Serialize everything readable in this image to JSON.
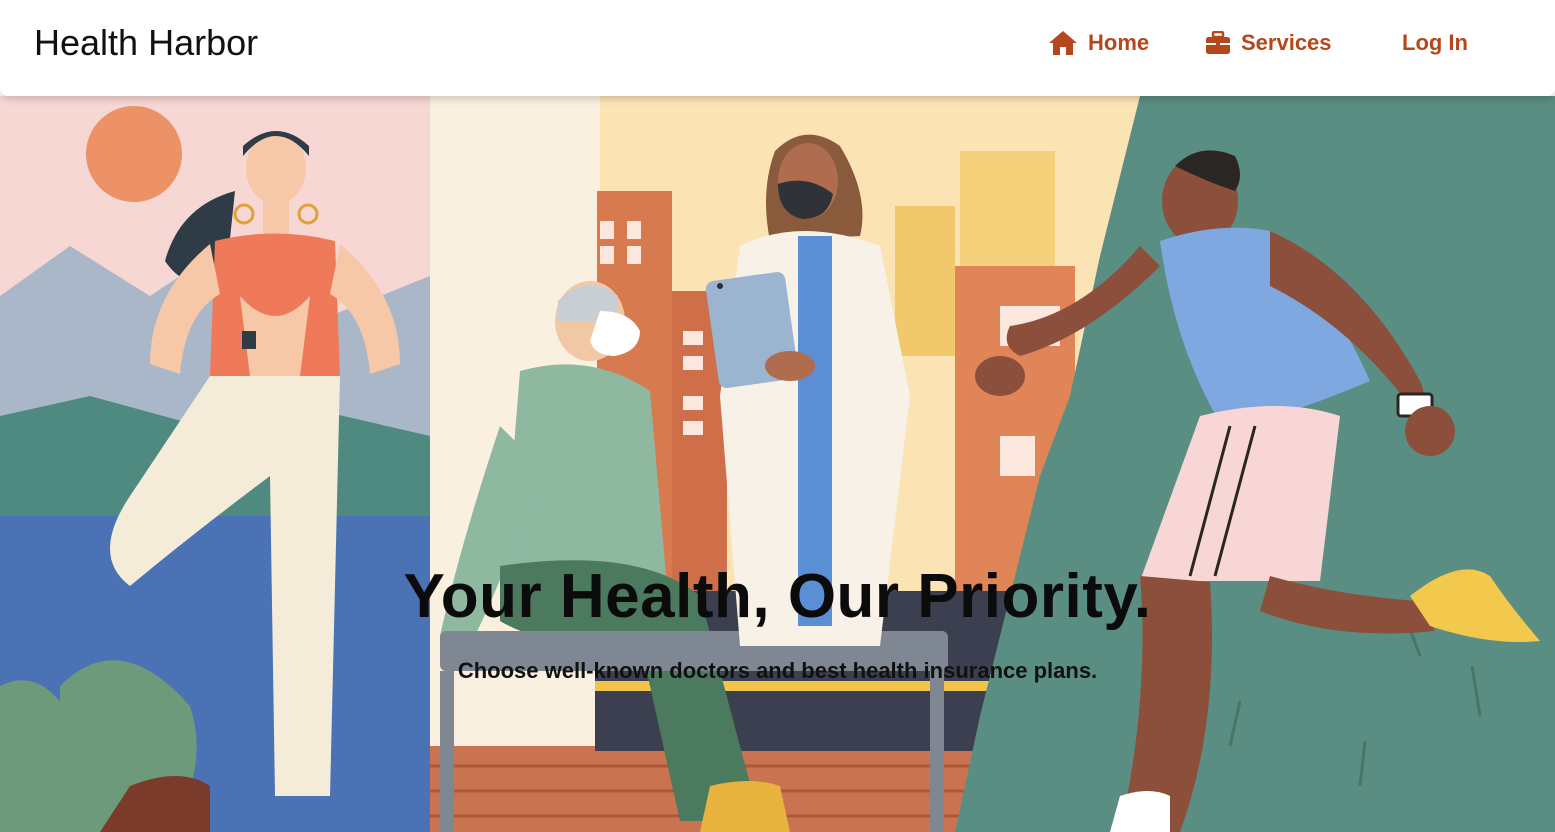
{
  "brand": {
    "name": "Health Harbor"
  },
  "nav": {
    "home": {
      "label": "Home",
      "icon": "home-icon"
    },
    "services": {
      "label": "Services",
      "icon": "briefcase-icon"
    },
    "login": {
      "label": "Log In"
    }
  },
  "hero": {
    "headline": "Your Health, Our Priority.",
    "subheadline": "Choose well-known doctors and best health insurance plans.",
    "illustration": "wellness-illustration"
  },
  "colors": {
    "accent": "#b5471c",
    "navbar_bg": "#ffffff",
    "headline_text": "#0b0b0b"
  }
}
